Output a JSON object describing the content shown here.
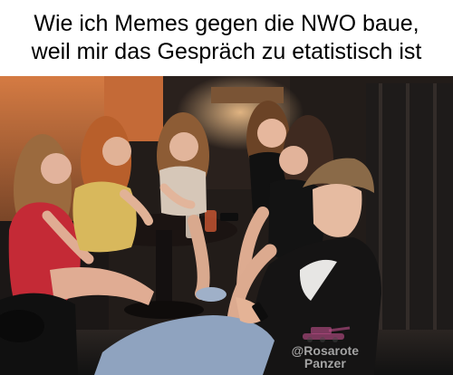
{
  "caption": {
    "line1": "Wie ich Memes gegen die NWO baue,",
    "line2": "weil mir das Gespräch zu etatistisch ist"
  },
  "watermark": {
    "handle": "@Rosarote",
    "name": "Panzer"
  },
  "colors": {
    "caption_bg": "#ffffff",
    "caption_text": "#000000",
    "wall_orange": "#c9703a",
    "room_dark": "#1f1a17",
    "red_dress": "#c42a36",
    "yellow_dress": "#d8b85c",
    "jeans": "#8fa3bf"
  }
}
